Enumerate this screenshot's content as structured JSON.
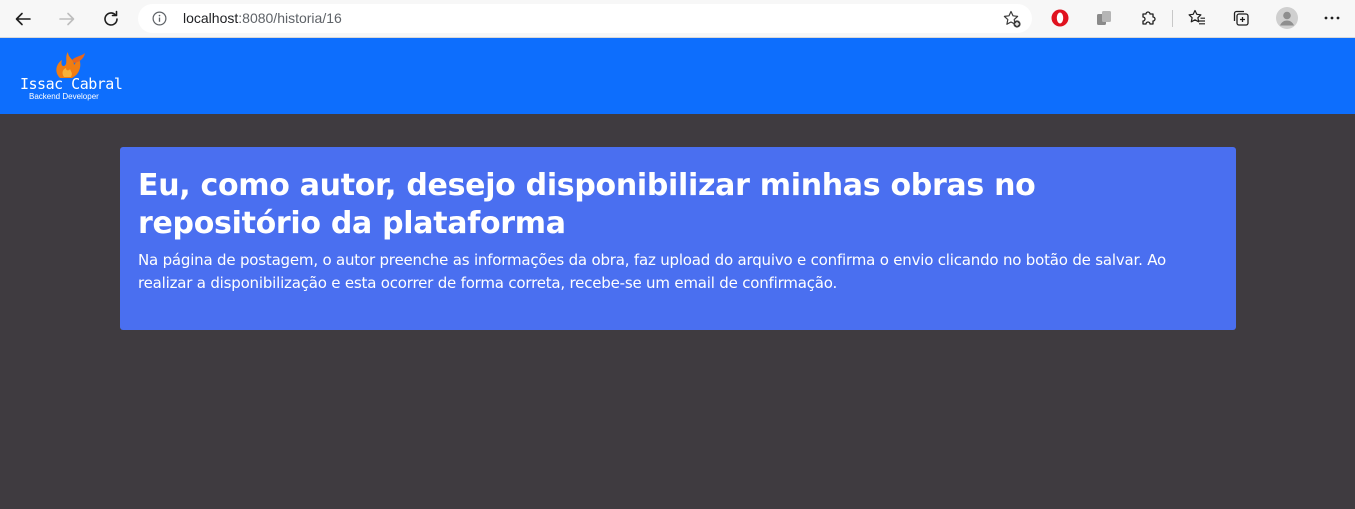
{
  "browser": {
    "url_host": "localhost",
    "url_path": ":8080/historia/16",
    "icons": {
      "back": "arrow-left-icon",
      "forward": "arrow-right-icon",
      "reload": "reload-icon",
      "site_info": "info-icon",
      "favorite": "star-plus-icon",
      "opera": "opera-extension-icon",
      "extension2": "extension-icon",
      "extensions": "puzzle-icon",
      "favorites": "star-list-icon",
      "collections": "collections-icon",
      "profile": "profile-avatar-icon",
      "menu": "more-icon"
    }
  },
  "site": {
    "brand_name": "Issac Cabral",
    "brand_subtitle": "Backend Developer",
    "header_color": "#0d6efd"
  },
  "story": {
    "title": "Eu, como autor, desejo disponibilizar minhas obras no repositório da plataforma",
    "description": "Na página de postagem, o autor preenche as informações da obra, faz upload do arquivo e confirma o envio clicando no botão de salvar. Ao realizar a disponibilização e esta ocorrer de forma correta, recebe-se um email de confirmação.",
    "card_color": "#4a6ff0"
  },
  "page": {
    "background_color": "#3f3b40"
  }
}
